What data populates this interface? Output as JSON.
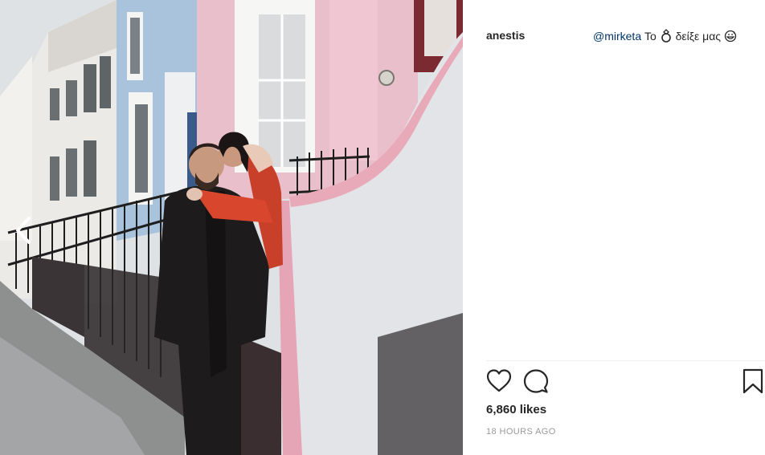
{
  "post": {
    "username": "anestis",
    "caption": {
      "mention": "@mirketa",
      "text_before_emoji": "Το",
      "text_after_emoji": "δείξε μας"
    },
    "likes": "6,860 likes",
    "timestamp": "18 HOURS AGO"
  },
  "icons": {
    "carousel_prev": "chevron-left-icon",
    "like": "heart-icon",
    "comment": "speech-bubble-icon",
    "save": "bookmark-icon",
    "emoji_1": "ring-emoji-icon",
    "emoji_2": "grinning-sweat-emoji-icon"
  },
  "colors": {
    "mention": "#003569",
    "text": "#262626",
    "muted": "#999999",
    "divider": "#efefef"
  }
}
